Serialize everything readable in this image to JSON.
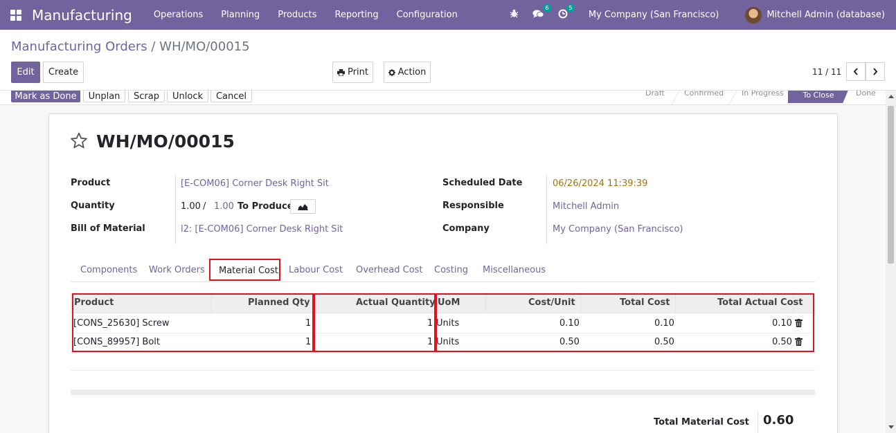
{
  "navbar": {
    "brand": "Manufacturing",
    "menu": [
      "Operations",
      "Planning",
      "Products",
      "Reporting",
      "Configuration"
    ],
    "messages_count": "6",
    "activities_count": "5",
    "company": "My Company (San Francisco)",
    "user": "Mitchell Admin (database)"
  },
  "breadcrumb": {
    "parent": "Manufacturing Orders",
    "separator": "/",
    "current": "WH/MO/00015"
  },
  "buttons": {
    "edit": "Edit",
    "create": "Create",
    "print": "Print",
    "action": "Action"
  },
  "pager": {
    "value": "11 / 11"
  },
  "statusbar": {
    "buttons": [
      "Mark as Done",
      "Unplan",
      "Scrap",
      "Unlock",
      "Cancel"
    ],
    "stages": [
      "Draft",
      "Confirmed",
      "In Progress",
      "To Close",
      "Done"
    ],
    "active_stage": "To Close"
  },
  "record": {
    "title": "WH/MO/00015",
    "fields": {
      "product_label": "Product",
      "product_value": "[E-COM06] Corner Desk Right Sit",
      "quantity_label": "Quantity",
      "quantity_done": "1.00",
      "quantity_sep": "/",
      "quantity_total": "1.00",
      "quantity_suffix": "To Produce",
      "bom_label": "Bill of Material",
      "bom_value": "l2: [E-COM06] Corner Desk Right Sit",
      "scheduled_label": "Scheduled Date",
      "scheduled_value": "06/26/2024 11:39:39",
      "responsible_label": "Responsible",
      "responsible_value": "Mitchell Admin",
      "company_label": "Company",
      "company_value": "My Company (San Francisco)"
    }
  },
  "tabs": [
    "Components",
    "Work Orders",
    "Material Cost",
    "Labour Cost",
    "Overhead Cost",
    "Costing",
    "Miscellaneous"
  ],
  "active_tab": "Material Cost",
  "table": {
    "headers": [
      "Product",
      "Planned Qty",
      "Actual Quantity",
      "UoM",
      "Cost/Unit",
      "Total Cost",
      "Total Actual Cost"
    ],
    "rows": [
      {
        "product": "[CONS_25630] Screw",
        "planned": "1",
        "actual": "1",
        "uom": "Units",
        "cost_unit": "0.10",
        "total": "0.10",
        "total_actual": "0.10"
      },
      {
        "product": "[CONS_89957] Bolt",
        "planned": "1",
        "actual": "1",
        "uom": "Units",
        "cost_unit": "0.50",
        "total": "0.50",
        "total_actual": "0.50"
      }
    ]
  },
  "totals": {
    "label": "Total Material Cost",
    "value": "0.60"
  },
  "colors": {
    "brand": "#71639e",
    "highlight": "#e0121f"
  }
}
